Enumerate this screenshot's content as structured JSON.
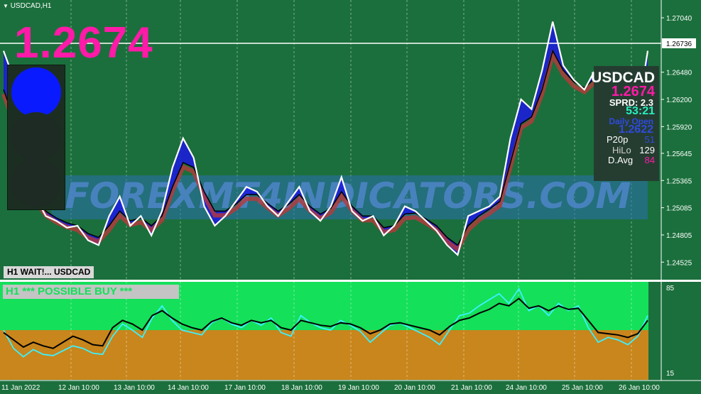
{
  "symbol_label": "USDCAD,H1",
  "big_price": "1.2674",
  "current_price_tag": "1.26736",
  "watermark": "FOREXMT4INDICATORS.COM",
  "status_wait": "H1 WAIT!... USDCAD",
  "status_signal": "H1 *** POSSIBLE BUY ***",
  "info_panel": {
    "symbol": "USDCAD",
    "price": "1.2674",
    "spread": "SPRD: 2.3",
    "timer": "53:21",
    "daily_open_label": "Daily Open",
    "daily_open_value": "1.2622",
    "rows": [
      {
        "label": "P20p",
        "value": "51"
      },
      {
        "label": "HiLo",
        "value": "129"
      },
      {
        "label": "D.Avg",
        "value": "84"
      }
    ]
  },
  "colors": {
    "background": "#1b6f3c",
    "oscillator_upper": "#14e05a",
    "oscillator_lower": "#c8861c",
    "price_line": "#ffffff",
    "band_blue": "#1a1adf",
    "band_red": "#b83a3a",
    "big_price": "#ff1aa8",
    "traffic_light_on": "#0a1aff"
  },
  "chart_data": [
    {
      "type": "line",
      "title": "USDCAD,H1",
      "y_ticks": [
        "1.27040",
        "1.26480",
        "1.26200",
        "1.25920",
        "1.25645",
        "1.25365",
        "1.25085",
        "1.24805",
        "1.24525"
      ],
      "y_current": 1.26736,
      "ylim": [
        1.2441,
        1.2715
      ],
      "x_ticks": [
        "11 Jan 2022",
        "12 Jan 10:00",
        "13 Jan 10:00",
        "14 Jan 10:00",
        "17 Jan 10:00",
        "18 Jan 10:00",
        "19 Jan 10:00",
        "20 Jan 10:00",
        "21 Jan 10:00",
        "24 Jan 10:00",
        "25 Jan 10:00",
        "26 Jan 10:00"
      ],
      "series": [
        {
          "values": [
            1.267,
            1.264,
            1.256,
            1.252,
            1.25,
            1.2495,
            1.2488,
            1.249,
            1.2475,
            1.247,
            1.25,
            1.252,
            1.249,
            1.25,
            1.248,
            1.2505,
            1.255,
            1.258,
            1.256,
            1.251,
            1.249,
            1.25,
            1.2515,
            1.253,
            1.2525,
            1.251,
            1.25,
            1.2515,
            1.253,
            1.2505,
            1.2495,
            1.251,
            1.254,
            1.2505,
            1.2495,
            1.25,
            1.248,
            1.249,
            1.251,
            1.2505,
            1.2495,
            1.2485,
            1.247,
            1.246,
            1.25,
            1.2505,
            1.251,
            1.252,
            1.258,
            1.262,
            1.261,
            1.265,
            1.27,
            1.2655,
            1.264,
            1.263,
            1.265,
            1.264,
            1.2645,
            1.262,
            1.26,
            1.267
          ]
        },
        {
          "values": [
            1.263,
            1.26,
            1.2545,
            1.252,
            1.2505,
            1.2498,
            1.2493,
            1.249,
            1.2482,
            1.2478,
            1.249,
            1.2505,
            1.2495,
            1.2498,
            1.249,
            1.25,
            1.253,
            1.2555,
            1.255,
            1.2525,
            1.2505,
            1.2505,
            1.2512,
            1.2522,
            1.2522,
            1.2513,
            1.2505,
            1.2512,
            1.2522,
            1.251,
            1.2502,
            1.2508,
            1.2525,
            1.251,
            1.25,
            1.25,
            1.2488,
            1.249,
            1.2502,
            1.2503,
            1.2497,
            1.249,
            1.2478,
            1.247,
            1.249,
            1.25,
            1.2507,
            1.2515,
            1.2555,
            1.2595,
            1.2602,
            1.263,
            1.267,
            1.265,
            1.2638,
            1.2632,
            1.2642,
            1.2638,
            1.264,
            1.2625,
            1.2612,
            1.2645
          ]
        }
      ]
    },
    {
      "type": "line",
      "title": "",
      "y_ticks": [
        "85",
        "15"
      ],
      "ylim": [
        12,
        88
      ],
      "series": [
        {
          "values": [
            50,
            35,
            28,
            34,
            30,
            29,
            33,
            37,
            35,
            31,
            30,
            45,
            55,
            50,
            44,
            60,
            70,
            58,
            50,
            48,
            46,
            56,
            60,
            55,
            52,
            58,
            54,
            60,
            48,
            45,
            62,
            56,
            52,
            50,
            58,
            54,
            49,
            40,
            47,
            54,
            56,
            52,
            48,
            44,
            38,
            50,
            62,
            64,
            70,
            75,
            80,
            72,
            84,
            66,
            70,
            62,
            72,
            66,
            70,
            52,
            40,
            44,
            42,
            38,
            45,
            62
          ]
        },
        {
          "values": [
            48,
            42,
            36,
            40,
            37,
            35,
            40,
            45,
            42,
            38,
            37,
            52,
            58,
            55,
            50,
            62,
            66,
            60,
            55,
            52,
            50,
            57,
            60,
            56,
            54,
            58,
            56,
            58,
            52,
            50,
            58,
            56,
            54,
            53,
            56,
            55,
            52,
            47,
            50,
            55,
            56,
            54,
            52,
            50,
            46,
            53,
            58,
            60,
            64,
            67,
            72,
            70,
            76,
            68,
            70,
            66,
            70,
            67,
            68,
            58,
            48,
            47,
            46,
            44,
            47,
            58
          ]
        }
      ]
    }
  ]
}
